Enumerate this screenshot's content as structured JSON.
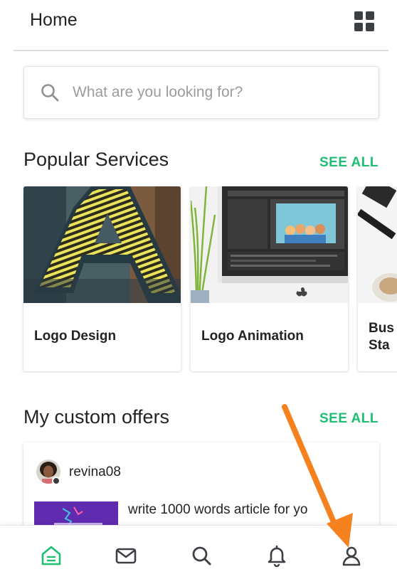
{
  "header": {
    "title": "Home",
    "menu_icon": "grid-icon"
  },
  "search": {
    "placeholder": "What are you looking for?",
    "value": "",
    "icon": "search-icon"
  },
  "popular": {
    "title": "Popular Services",
    "see_all": "SEE ALL",
    "cards": [
      {
        "label": "Logo Design"
      },
      {
        "label": "Logo Animation"
      },
      {
        "label": "Business Stationery",
        "visible_label": "Bus Sta"
      }
    ]
  },
  "offers": {
    "title": "My custom offers",
    "see_all": "SEE ALL",
    "items": [
      {
        "username": "revina08",
        "description": "write 1000 words article for yo"
      }
    ]
  },
  "bottom_nav": {
    "items": [
      {
        "name": "home",
        "icon": "home-icon",
        "active": true
      },
      {
        "name": "inbox",
        "icon": "mail-icon",
        "active": false
      },
      {
        "name": "search",
        "icon": "search-icon",
        "active": false
      },
      {
        "name": "notifications",
        "icon": "bell-icon",
        "active": false
      },
      {
        "name": "profile",
        "icon": "profile-icon",
        "active": false
      }
    ]
  },
  "colors": {
    "accent": "#1dbf73",
    "annotation_arrow": "#f5821f",
    "text": "#222325",
    "muted": "#9a9ca0"
  }
}
